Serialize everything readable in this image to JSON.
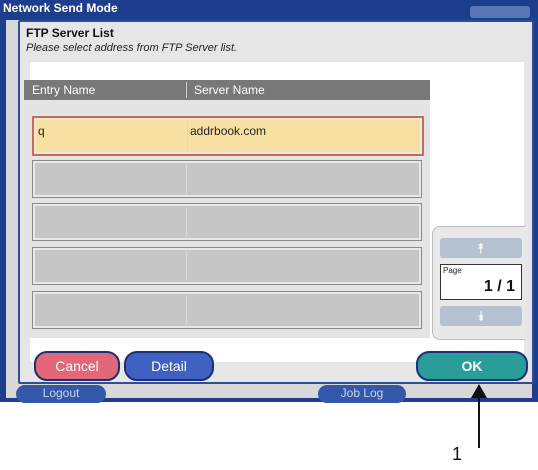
{
  "window": {
    "title": "Network Send Mode"
  },
  "background_buttons": {
    "logout": "Logout",
    "job_log": "Job Log"
  },
  "dialog": {
    "title": "FTP Server List",
    "subtitle": "Please select address from FTP Server list."
  },
  "list": {
    "columns": [
      "Entry Name",
      "Server Name"
    ],
    "rows": [
      {
        "entry": "q",
        "server": "addrbook.com",
        "selected": true
      },
      {
        "entry": "",
        "server": ""
      },
      {
        "entry": "",
        "server": ""
      },
      {
        "entry": "",
        "server": ""
      },
      {
        "entry": "",
        "server": ""
      }
    ]
  },
  "pager": {
    "label": "Page",
    "value": "1 / 1"
  },
  "buttons": {
    "cancel": "Cancel",
    "detail": "Detail",
    "ok": "OK"
  },
  "callout": {
    "number": "1"
  },
  "colors": {
    "window_blue": "#1d3e8c",
    "selected_row": "#f7e0a1",
    "selected_border": "#cc6a4d",
    "cancel_button": "#e16878",
    "detail_button": "#3f62c2",
    "ok_button": "#2a9c9a"
  },
  "icons": {
    "page_up": "double-chevron-up-icon",
    "page_down": "double-chevron-down-icon"
  }
}
